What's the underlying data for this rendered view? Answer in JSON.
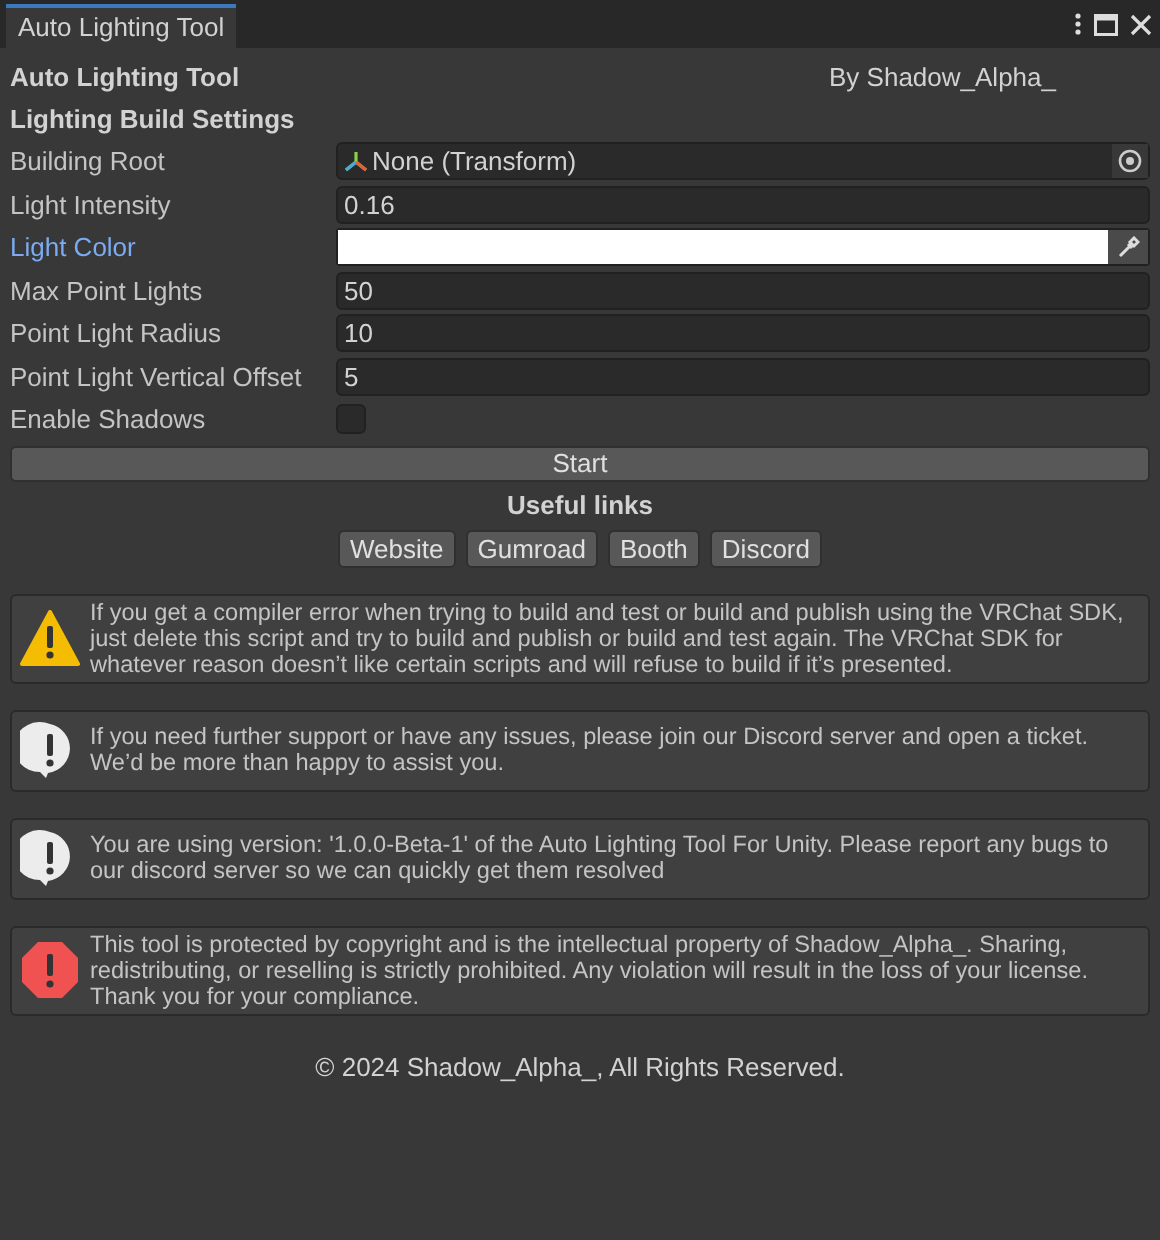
{
  "window": {
    "tab": "Auto Lighting Tool"
  },
  "header": {
    "title": "Auto Lighting Tool",
    "author": "By Shadow_Alpha_"
  },
  "section_title": "Lighting Build Settings",
  "fields": [
    {
      "kind": "object",
      "label": "Building Root",
      "value": "None (Transform)",
      "focused": false
    },
    {
      "kind": "text",
      "label": "Light Intensity",
      "value": "0.16",
      "focused": false
    },
    {
      "kind": "color",
      "label": "Light Color",
      "color": "#ffffff",
      "focused": true
    },
    {
      "kind": "text",
      "label": "Max Point Lights",
      "value": "50",
      "focused": false
    },
    {
      "kind": "text",
      "label": "Point Light Radius",
      "value": "10",
      "focused": false
    },
    {
      "kind": "text",
      "label": "Point Light Vertical Offset",
      "value": "5",
      "focused": false
    },
    {
      "kind": "checkbox",
      "label": "Enable Shadows",
      "checked": false,
      "focused": false
    }
  ],
  "start_button": "Start",
  "links_title": "Useful links",
  "links": [
    "Website",
    "Gumroad",
    "Booth",
    "Discord"
  ],
  "messages": [
    {
      "kind": "warning",
      "text": "If you get a compiler error when trying to build and test or build and publish using the VRChat SDK, just delete this script and try to build and publish or build and test again. The VRChat SDK for whatever reason doesn’t like certain scripts and will refuse to build if it’s presented."
    },
    {
      "kind": "info",
      "text": "If you need further support or have any issues, please join our Discord server and open a ticket. We’d be more than happy to assist you."
    },
    {
      "kind": "info",
      "text": "You are using version: '1.0.0-Beta-1' of the Auto Lighting Tool For Unity. Please report any bugs to our discord server so we can quickly get them resolved"
    },
    {
      "kind": "error",
      "text": "This tool is protected by copyright and is the intellectual property of Shadow_Alpha_. Sharing, redistributing, or reselling is strictly prohibited. Any violation will result in the loss of your license. Thank you for your compliance."
    }
  ],
  "footer": "© 2024 Shadow_Alpha_, All Rights Reserved."
}
